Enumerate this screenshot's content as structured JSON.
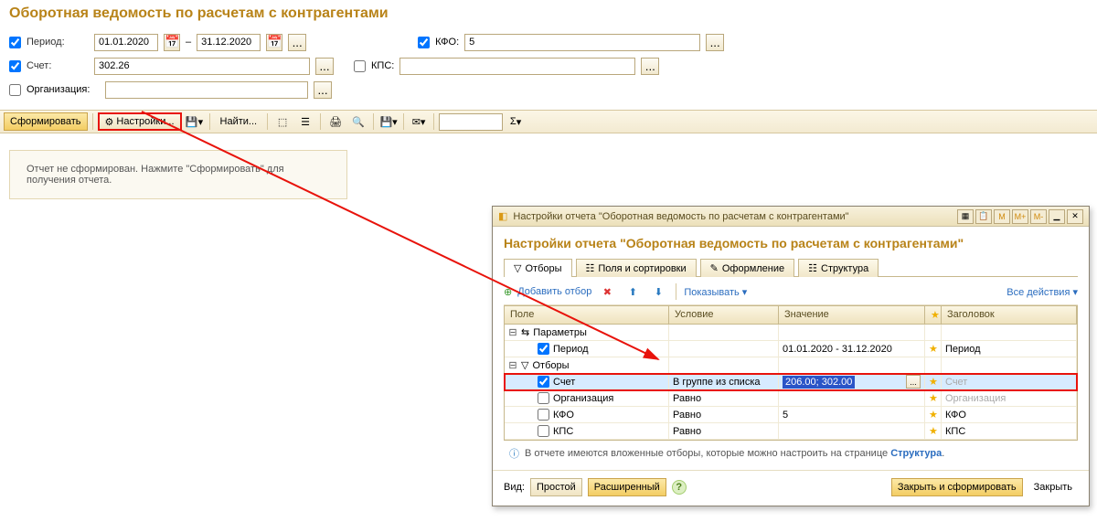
{
  "title": "Оборотная ведомость по расчетам с контрагентами",
  "params": {
    "period_label": "Период:",
    "period_from": "01.01.2020",
    "period_to": "31.12.2020",
    "dash": "–",
    "account_label": "Счет:",
    "account_value": "302.26",
    "org_label": "Организация:",
    "org_value": "",
    "kfo_label": "КФО:",
    "kfo_value": "5",
    "kps_label": "КПС:",
    "kps_value": ""
  },
  "toolbar": {
    "generate": "Сформировать",
    "settings": "Настройки...",
    "find": "Найти...",
    "sigma": "Σ"
  },
  "message": "Отчет не сформирован. Нажмите \"Сформировать\" для получения отчета.",
  "modal": {
    "titlebar": "Настройки отчета \"Оборотная ведомость по расчетам с контрагентами\"",
    "m": "M",
    "mplus": "M+",
    "mminus": "M-",
    "heading": "Настройки отчета \"Оборотная ведомость по расчетам с контрагентами\"",
    "tabs": {
      "filters": "Отборы",
      "fields": "Поля и сортировки",
      "design": "Оформление",
      "structure": "Структура"
    },
    "actions": {
      "add": "Добавить отбор",
      "show": "Показывать",
      "all": "Все действия"
    },
    "grid": {
      "headers": {
        "field": "Поле",
        "cond": "Условие",
        "value": "Значение",
        "title": "Заголовок"
      },
      "group_params": "Параметры",
      "group_filters": "Отборы",
      "rows": [
        {
          "field": "Период",
          "cond": "",
          "value": "01.01.2020 - 31.12.2020",
          "title": "Период",
          "checked": true,
          "muted": false
        },
        {
          "field": "Счет",
          "cond": "В группе из списка",
          "value": "206.00; 302.00",
          "title": "Счет",
          "checked": true,
          "muted": true,
          "selected": true
        },
        {
          "field": "Организация",
          "cond": "Равно",
          "value": "",
          "title": "Организация",
          "checked": false,
          "muted": true
        },
        {
          "field": "КФО",
          "cond": "Равно",
          "value": "5",
          "title": "КФО",
          "checked": false,
          "muted": false
        },
        {
          "field": "КПС",
          "cond": "Равно",
          "value": "",
          "title": "КПС",
          "checked": false,
          "muted": false
        }
      ]
    },
    "info_prefix": "В отчете имеются вложенные отборы, которые можно настроить на странице ",
    "info_link": "Структура",
    "info_suffix": ".",
    "footer": {
      "view": "Вид:",
      "simple": "Простой",
      "extended": "Расширенный",
      "close_run": "Закрыть и сформировать",
      "close": "Закрыть"
    }
  }
}
